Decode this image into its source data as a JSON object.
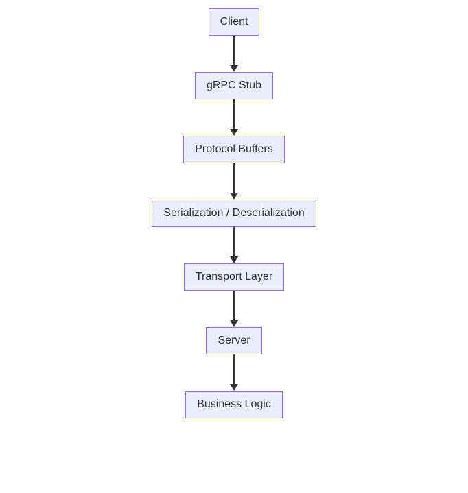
{
  "diagram": {
    "type": "flowchart",
    "direction": "top-down",
    "nodes": [
      {
        "id": "client",
        "label": "Client"
      },
      {
        "id": "grpc-stub",
        "label": "gRPC Stub"
      },
      {
        "id": "protocol-buffers",
        "label": "Protocol Buffers"
      },
      {
        "id": "serialization",
        "label": "Serialization / Deserialization"
      },
      {
        "id": "transport-layer",
        "label": "Transport Layer"
      },
      {
        "id": "server",
        "label": "Server"
      },
      {
        "id": "business-logic",
        "label": "Business Logic"
      }
    ],
    "edges": [
      {
        "from": "client",
        "to": "grpc-stub"
      },
      {
        "from": "grpc-stub",
        "to": "protocol-buffers"
      },
      {
        "from": "protocol-buffers",
        "to": "serialization"
      },
      {
        "from": "serialization",
        "to": "transport-layer"
      },
      {
        "from": "transport-layer",
        "to": "server"
      },
      {
        "from": "server",
        "to": "business-logic"
      }
    ],
    "style": {
      "node_fill": "#ECECFF",
      "node_border": "#9370DB",
      "edge_color": "#333333"
    }
  }
}
